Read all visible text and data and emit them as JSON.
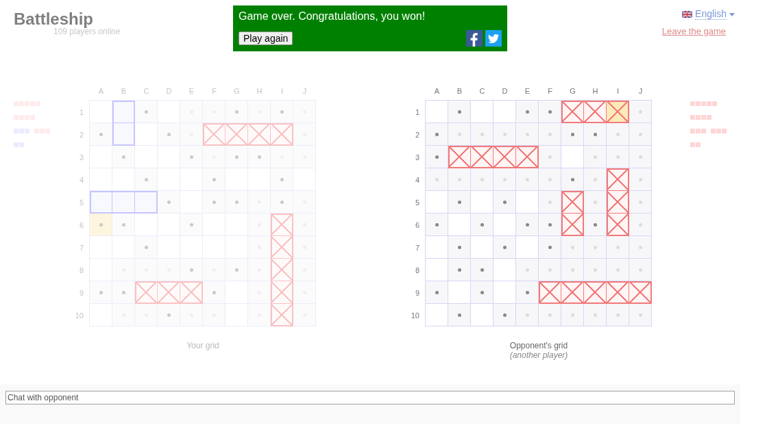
{
  "header": {
    "title": "Battleship",
    "players_online": "109 players online"
  },
  "banner": {
    "message": "Game over. Congratulations, you won!",
    "button": "Play again"
  },
  "language": {
    "label": "English"
  },
  "leave_link": "Leave the game",
  "boards": [
    {
      "caption": "Your grid",
      "disabled": true,
      "fleet": [
        {
          "ships": [
            {
              "squares": [
                {
                  "sunk": true
                },
                {
                  "sunk": true
                },
                {
                  "sunk": true
                },
                {
                  "sunk": true
                },
                {
                  "sunk": true
                }
              ]
            }
          ]
        },
        {
          "ships": [
            {
              "squares": [
                {
                  "sunk": true
                },
                {
                  "sunk": true
                },
                {
                  "sunk": true
                },
                {
                  "sunk": true
                }
              ]
            }
          ]
        },
        {
          "ships": [
            {
              "squares": [
                {
                  "sunk": false
                },
                {
                  "sunk": false
                },
                {
                  "sunk": false
                }
              ]
            },
            {
              "squares": [
                {
                  "sunk": true
                },
                {
                  "sunk": true
                },
                {
                  "sunk": true
                }
              ]
            }
          ]
        },
        {
          "ships": [
            {
              "squares": [
                {
                  "sunk": false
                },
                {
                  "sunk": false
                }
              ]
            }
          ]
        }
      ],
      "columns": [
        "A",
        "B",
        "C",
        "D",
        "E",
        "F",
        "G",
        "H",
        "I",
        "J"
      ],
      "rows": [
        {
          "label": "1",
          "cells": [
            {
              "kind": "empty",
              "highlighted": false
            },
            {
              "kind": "ship",
              "highlighted": false
            },
            {
              "kind": "miss",
              "highlighted": false
            },
            {
              "kind": "empty",
              "highlighted": false
            },
            {
              "kind": "marked",
              "highlighted": false
            },
            {
              "kind": "marked",
              "highlighted": false
            },
            {
              "kind": "miss",
              "highlighted": false
            },
            {
              "kind": "marked",
              "highlighted": false
            },
            {
              "kind": "miss",
              "highlighted": false
            },
            {
              "kind": "marked",
              "highlighted": false
            }
          ]
        },
        {
          "label": "2",
          "cells": [
            {
              "kind": "miss",
              "highlighted": false
            },
            {
              "kind": "ship",
              "highlighted": false
            },
            {
              "kind": "empty",
              "highlighted": false
            },
            {
              "kind": "miss",
              "highlighted": false
            },
            {
              "kind": "marked",
              "highlighted": false
            },
            {
              "kind": "hit",
              "highlighted": false
            },
            {
              "kind": "hit",
              "highlighted": false
            },
            {
              "kind": "hit",
              "highlighted": false
            },
            {
              "kind": "hit",
              "highlighted": false
            },
            {
              "kind": "marked",
              "highlighted": false
            }
          ]
        },
        {
          "label": "3",
          "cells": [
            {
              "kind": "empty",
              "highlighted": false
            },
            {
              "kind": "miss",
              "highlighted": false
            },
            {
              "kind": "empty",
              "highlighted": false
            },
            {
              "kind": "empty",
              "highlighted": false
            },
            {
              "kind": "miss",
              "highlighted": false
            },
            {
              "kind": "marked",
              "highlighted": false
            },
            {
              "kind": "miss",
              "highlighted": false
            },
            {
              "kind": "miss",
              "highlighted": false
            },
            {
              "kind": "marked",
              "highlighted": false
            },
            {
              "kind": "marked",
              "highlighted": false
            }
          ]
        },
        {
          "label": "4",
          "cells": [
            {
              "kind": "empty",
              "highlighted": false
            },
            {
              "kind": "empty",
              "highlighted": false
            },
            {
              "kind": "miss",
              "highlighted": false
            },
            {
              "kind": "empty",
              "highlighted": false
            },
            {
              "kind": "empty",
              "highlighted": false
            },
            {
              "kind": "miss",
              "highlighted": false
            },
            {
              "kind": "empty",
              "highlighted": false
            },
            {
              "kind": "empty",
              "highlighted": false
            },
            {
              "kind": "miss",
              "highlighted": false
            },
            {
              "kind": "empty",
              "highlighted": false
            }
          ]
        },
        {
          "label": "5",
          "cells": [
            {
              "kind": "ship",
              "highlighted": false
            },
            {
              "kind": "ship",
              "highlighted": false
            },
            {
              "kind": "ship",
              "highlighted": false
            },
            {
              "kind": "miss",
              "highlighted": false
            },
            {
              "kind": "empty",
              "highlighted": false
            },
            {
              "kind": "miss",
              "highlighted": false
            },
            {
              "kind": "miss",
              "highlighted": false
            },
            {
              "kind": "marked",
              "highlighted": false
            },
            {
              "kind": "miss",
              "highlighted": false
            },
            {
              "kind": "marked",
              "highlighted": false
            }
          ]
        },
        {
          "label": "6",
          "cells": [
            {
              "kind": "miss",
              "highlighted": true
            },
            {
              "kind": "miss",
              "highlighted": false
            },
            {
              "kind": "empty",
              "highlighted": false
            },
            {
              "kind": "empty",
              "highlighted": false
            },
            {
              "kind": "miss",
              "highlighted": false
            },
            {
              "kind": "empty",
              "highlighted": false
            },
            {
              "kind": "empty",
              "highlighted": false
            },
            {
              "kind": "marked",
              "highlighted": false
            },
            {
              "kind": "hit",
              "highlighted": false
            },
            {
              "kind": "marked",
              "highlighted": false
            }
          ]
        },
        {
          "label": "7",
          "cells": [
            {
              "kind": "empty",
              "highlighted": false
            },
            {
              "kind": "empty",
              "highlighted": false
            },
            {
              "kind": "miss",
              "highlighted": false
            },
            {
              "kind": "empty",
              "highlighted": false
            },
            {
              "kind": "empty",
              "highlighted": false
            },
            {
              "kind": "empty",
              "highlighted": false
            },
            {
              "kind": "empty",
              "highlighted": false
            },
            {
              "kind": "marked",
              "highlighted": false
            },
            {
              "kind": "hit",
              "highlighted": false
            },
            {
              "kind": "marked",
              "highlighted": false
            }
          ]
        },
        {
          "label": "8",
          "cells": [
            {
              "kind": "empty",
              "highlighted": false
            },
            {
              "kind": "marked",
              "highlighted": false
            },
            {
              "kind": "marked",
              "highlighted": false
            },
            {
              "kind": "marked",
              "highlighted": false
            },
            {
              "kind": "miss",
              "highlighted": false
            },
            {
              "kind": "marked",
              "highlighted": false
            },
            {
              "kind": "miss",
              "highlighted": false
            },
            {
              "kind": "marked",
              "highlighted": false
            },
            {
              "kind": "hit",
              "highlighted": false
            },
            {
              "kind": "marked",
              "highlighted": false
            }
          ]
        },
        {
          "label": "9",
          "cells": [
            {
              "kind": "miss",
              "highlighted": false
            },
            {
              "kind": "miss",
              "highlighted": false
            },
            {
              "kind": "hit",
              "highlighted": false
            },
            {
              "kind": "hit",
              "highlighted": false
            },
            {
              "kind": "hit",
              "highlighted": false
            },
            {
              "kind": "miss",
              "highlighted": false
            },
            {
              "kind": "empty",
              "highlighted": false
            },
            {
              "kind": "marked",
              "highlighted": false
            },
            {
              "kind": "hit",
              "highlighted": false
            },
            {
              "kind": "marked",
              "highlighted": false
            }
          ]
        },
        {
          "label": "10",
          "cells": [
            {
              "kind": "empty",
              "highlighted": false
            },
            {
              "kind": "marked",
              "highlighted": false
            },
            {
              "kind": "marked",
              "highlighted": false
            },
            {
              "kind": "miss",
              "highlighted": false
            },
            {
              "kind": "marked",
              "highlighted": false
            },
            {
              "kind": "marked",
              "highlighted": false
            },
            {
              "kind": "empty",
              "highlighted": false
            },
            {
              "kind": "marked",
              "highlighted": false
            },
            {
              "kind": "hit",
              "highlighted": false
            },
            {
              "kind": "marked",
              "highlighted": false
            }
          ]
        }
      ]
    },
    {
      "caption": "Opponent's grid",
      "subcaption": "(another player)",
      "disabled": false,
      "fleet": [
        {
          "ships": [
            {
              "squares": [
                {
                  "sunk": true
                },
                {
                  "sunk": true
                },
                {
                  "sunk": true
                },
                {
                  "sunk": true
                },
                {
                  "sunk": true
                }
              ]
            }
          ]
        },
        {
          "ships": [
            {
              "squares": [
                {
                  "sunk": true
                },
                {
                  "sunk": true
                },
                {
                  "sunk": true
                },
                {
                  "sunk": true
                }
              ]
            }
          ]
        },
        {
          "ships": [
            {
              "squares": [
                {
                  "sunk": true
                },
                {
                  "sunk": true
                },
                {
                  "sunk": true
                }
              ]
            },
            {
              "squares": [
                {
                  "sunk": true
                },
                {
                  "sunk": true
                },
                {
                  "sunk": true
                }
              ]
            }
          ]
        },
        {
          "ships": [
            {
              "squares": [
                {
                  "sunk": true
                },
                {
                  "sunk": true
                }
              ]
            }
          ]
        }
      ],
      "columns": [
        "A",
        "B",
        "C",
        "D",
        "E",
        "F",
        "G",
        "H",
        "I",
        "J"
      ],
      "rows": [
        {
          "label": "1",
          "cells": [
            {
              "kind": "empty",
              "highlighted": false
            },
            {
              "kind": "miss",
              "highlighted": false
            },
            {
              "kind": "empty",
              "highlighted": false
            },
            {
              "kind": "empty",
              "highlighted": false
            },
            {
              "kind": "miss",
              "highlighted": false
            },
            {
              "kind": "miss",
              "highlighted": false
            },
            {
              "kind": "hit",
              "highlighted": false
            },
            {
              "kind": "hit",
              "highlighted": false
            },
            {
              "kind": "hit",
              "highlighted": true
            },
            {
              "kind": "marked",
              "highlighted": false
            }
          ]
        },
        {
          "label": "2",
          "cells": [
            {
              "kind": "miss",
              "highlighted": false
            },
            {
              "kind": "marked",
              "highlighted": false
            },
            {
              "kind": "marked",
              "highlighted": false
            },
            {
              "kind": "marked",
              "highlighted": false
            },
            {
              "kind": "marked",
              "highlighted": false
            },
            {
              "kind": "marked",
              "highlighted": false
            },
            {
              "kind": "miss",
              "highlighted": false
            },
            {
              "kind": "miss",
              "highlighted": false
            },
            {
              "kind": "marked",
              "highlighted": false
            },
            {
              "kind": "marked",
              "highlighted": false
            }
          ]
        },
        {
          "label": "3",
          "cells": [
            {
              "kind": "miss",
              "highlighted": false
            },
            {
              "kind": "hit",
              "highlighted": false
            },
            {
              "kind": "hit",
              "highlighted": false
            },
            {
              "kind": "hit",
              "highlighted": false
            },
            {
              "kind": "hit",
              "highlighted": false
            },
            {
              "kind": "marked",
              "highlighted": false
            },
            {
              "kind": "empty",
              "highlighted": false
            },
            {
              "kind": "marked",
              "highlighted": false
            },
            {
              "kind": "marked",
              "highlighted": false
            },
            {
              "kind": "marked",
              "highlighted": false
            }
          ]
        },
        {
          "label": "4",
          "cells": [
            {
              "kind": "marked",
              "highlighted": false
            },
            {
              "kind": "marked",
              "highlighted": false
            },
            {
              "kind": "marked",
              "highlighted": false
            },
            {
              "kind": "marked",
              "highlighted": false
            },
            {
              "kind": "marked",
              "highlighted": false
            },
            {
              "kind": "marked",
              "highlighted": false
            },
            {
              "kind": "miss",
              "highlighted": false
            },
            {
              "kind": "marked",
              "highlighted": false
            },
            {
              "kind": "hit",
              "highlighted": false
            },
            {
              "kind": "marked",
              "highlighted": false
            }
          ]
        },
        {
          "label": "5",
          "cells": [
            {
              "kind": "empty",
              "highlighted": false
            },
            {
              "kind": "miss",
              "highlighted": false
            },
            {
              "kind": "empty",
              "highlighted": false
            },
            {
              "kind": "miss",
              "highlighted": false
            },
            {
              "kind": "empty",
              "highlighted": false
            },
            {
              "kind": "marked",
              "highlighted": false
            },
            {
              "kind": "hit",
              "highlighted": false
            },
            {
              "kind": "marked",
              "highlighted": false
            },
            {
              "kind": "hit",
              "highlighted": false
            },
            {
              "kind": "marked",
              "highlighted": false
            }
          ]
        },
        {
          "label": "6",
          "cells": [
            {
              "kind": "miss",
              "highlighted": false
            },
            {
              "kind": "empty",
              "highlighted": false
            },
            {
              "kind": "miss",
              "highlighted": false
            },
            {
              "kind": "empty",
              "highlighted": false
            },
            {
              "kind": "miss",
              "highlighted": false
            },
            {
              "kind": "miss",
              "highlighted": false
            },
            {
              "kind": "hit",
              "highlighted": false
            },
            {
              "kind": "miss",
              "highlighted": false
            },
            {
              "kind": "hit",
              "highlighted": false
            },
            {
              "kind": "marked",
              "highlighted": false
            }
          ]
        },
        {
          "label": "7",
          "cells": [
            {
              "kind": "empty",
              "highlighted": false
            },
            {
              "kind": "miss",
              "highlighted": false
            },
            {
              "kind": "empty",
              "highlighted": false
            },
            {
              "kind": "miss",
              "highlighted": false
            },
            {
              "kind": "empty",
              "highlighted": false
            },
            {
              "kind": "miss",
              "highlighted": false
            },
            {
              "kind": "marked",
              "highlighted": false
            },
            {
              "kind": "marked",
              "highlighted": false
            },
            {
              "kind": "marked",
              "highlighted": false
            },
            {
              "kind": "marked",
              "highlighted": false
            }
          ]
        },
        {
          "label": "8",
          "cells": [
            {
              "kind": "empty",
              "highlighted": false
            },
            {
              "kind": "miss",
              "highlighted": false
            },
            {
              "kind": "miss",
              "highlighted": false
            },
            {
              "kind": "empty",
              "highlighted": false
            },
            {
              "kind": "marked",
              "highlighted": false
            },
            {
              "kind": "marked",
              "highlighted": false
            },
            {
              "kind": "marked",
              "highlighted": false
            },
            {
              "kind": "marked",
              "highlighted": false
            },
            {
              "kind": "marked",
              "highlighted": false
            },
            {
              "kind": "marked",
              "highlighted": false
            }
          ]
        },
        {
          "label": "9",
          "cells": [
            {
              "kind": "miss",
              "highlighted": false
            },
            {
              "kind": "empty",
              "highlighted": false
            },
            {
              "kind": "miss",
              "highlighted": false
            },
            {
              "kind": "empty",
              "highlighted": false
            },
            {
              "kind": "miss",
              "highlighted": false
            },
            {
              "kind": "hit",
              "highlighted": false
            },
            {
              "kind": "hit",
              "highlighted": false
            },
            {
              "kind": "hit",
              "highlighted": false
            },
            {
              "kind": "hit",
              "highlighted": false
            },
            {
              "kind": "hit",
              "highlighted": false
            }
          ]
        },
        {
          "label": "10",
          "cells": [
            {
              "kind": "empty",
              "highlighted": false
            },
            {
              "kind": "miss",
              "highlighted": false
            },
            {
              "kind": "empty",
              "highlighted": false
            },
            {
              "kind": "miss",
              "highlighted": false
            },
            {
              "kind": "marked",
              "highlighted": false
            },
            {
              "kind": "marked",
              "highlighted": false
            },
            {
              "kind": "marked",
              "highlighted": false
            },
            {
              "kind": "marked",
              "highlighted": false
            },
            {
              "kind": "marked",
              "highlighted": false
            },
            {
              "kind": "marked",
              "highlighted": false
            }
          ]
        }
      ]
    }
  ],
  "chat": {
    "placeholder": "Chat with opponent"
  }
}
